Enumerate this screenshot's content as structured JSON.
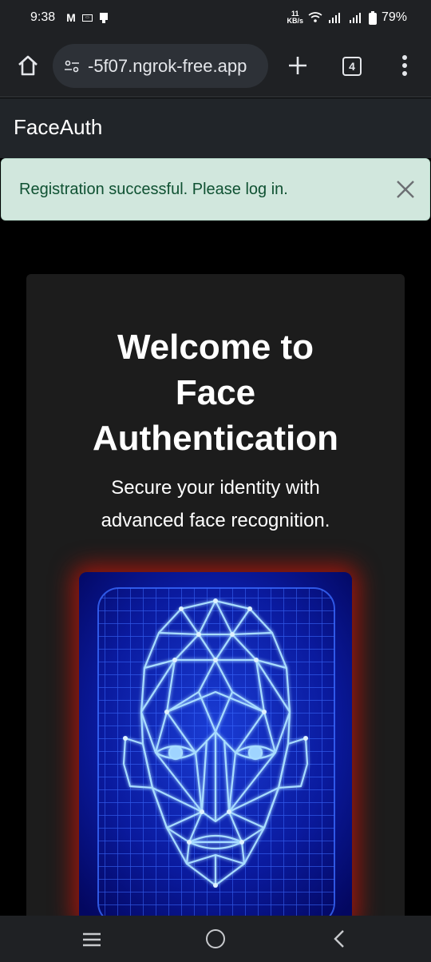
{
  "status_bar": {
    "time": "9:38",
    "mail_glyph": "M",
    "mini_badge": "▭",
    "net_speed_value": "11",
    "net_speed_unit": "KB/s",
    "battery": "79%"
  },
  "browser": {
    "url": "-5f07.ngrok-free.app",
    "tab_count": "4",
    "icons": [
      "home-icon",
      "tune-icon",
      "plus-icon",
      "tabs-icon",
      "more-vert-icon"
    ]
  },
  "navbar": {
    "brand": "FaceAuth"
  },
  "alert": {
    "message": "Registration successful. Please log in.",
    "bg_color": "#d1e7dd",
    "text_color": "#0f5132"
  },
  "hero": {
    "title_line1": "Welcome to",
    "title_line2": "Face",
    "title_line3": "Authentication",
    "subtitle_line1": "Secure your identity with",
    "subtitle_line2": "advanced face recognition."
  },
  "illustration": {
    "name": "wireframe-face-scan",
    "glow_color": "#c8140a",
    "line_color": "#9fd4ff"
  },
  "android_nav": {
    "icons": [
      "recent-apps-icon",
      "home-circle-icon",
      "back-icon"
    ]
  }
}
